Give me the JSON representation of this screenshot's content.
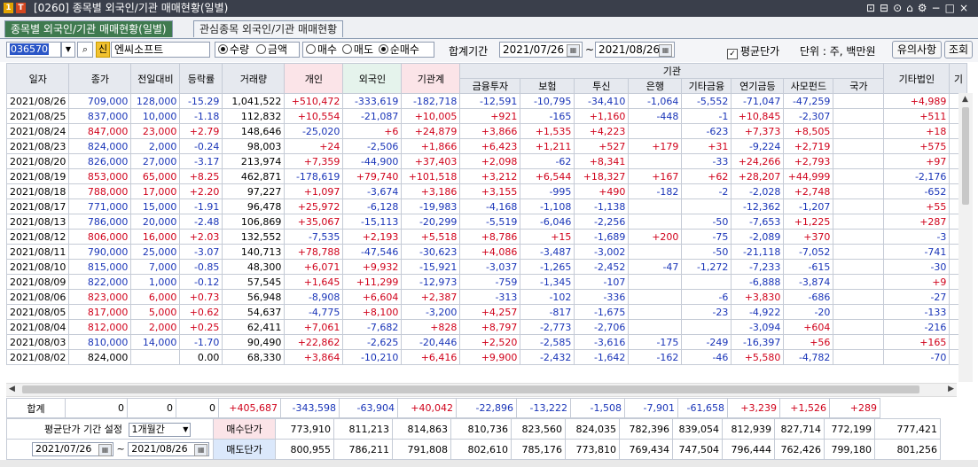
{
  "window": {
    "badge1": "1",
    "badge2": "T",
    "title": "[0260] 종목별 외국인/기관 매매현황(일별)",
    "controls": [
      "⊡",
      "⊟",
      "⊙",
      "⌂",
      "⚙",
      "−",
      "□",
      "×"
    ]
  },
  "tabs": [
    {
      "label": "종목별 외국인/기관 매매현황(일별)",
      "active": true
    },
    {
      "label": "관심종목 외국인/기관 매매현황",
      "active": false
    }
  ],
  "toolbar": {
    "code": "036570",
    "stock_badge": "신",
    "stock_name": "엔씨소프트",
    "radio_qty": "수량",
    "radio_amount": "금액",
    "radio_buy": "매수",
    "radio_sell": "매도",
    "radio_net": "순매수",
    "period_label": "합계기간",
    "date_from": "2021/07/26",
    "tilde": "~",
    "date_to": "2021/08/26",
    "avg_price_label": "평균단가",
    "unit_label": "단위 : 주, 백만원",
    "notice_button": "유의사항",
    "query_button": "조회"
  },
  "table": {
    "headers": {
      "date": "일자",
      "price": "종가",
      "change": "전일대비",
      "rate": "등락률",
      "volume": "거래량",
      "individual": "개인",
      "foreign": "외국인",
      "inst_total": "기관계",
      "inst_group": "기관",
      "inst_sub": [
        "금융투자",
        "보험",
        "투신",
        "은행",
        "기타금융",
        "연기금등",
        "사모펀드"
      ],
      "nation": "국가",
      "other_corp": "기타법인",
      "other_foreign": "기"
    },
    "rows": [
      [
        "2021/08/26",
        "709,000",
        "128,000",
        "-15.29",
        "1,041,522",
        "+510,472",
        "-333,619",
        "-182,718",
        "-12,591",
        "-10,795",
        "-34,410",
        "-1,064",
        "-5,552",
        "-71,047",
        "-47,259",
        "",
        "+4,989"
      ],
      [
        "2021/08/25",
        "837,000",
        "10,000",
        "-1.18",
        "112,832",
        "+10,554",
        "-21,087",
        "+10,005",
        "+921",
        "-165",
        "+1,160",
        "-448",
        "-1",
        "+10,845",
        "-2,307",
        "",
        "+511"
      ],
      [
        "2021/08/24",
        "847,000",
        "23,000",
        "+2.79",
        "148,646",
        "-25,020",
        "+6",
        "+24,879",
        "+3,866",
        "+1,535",
        "+4,223",
        "",
        "-623",
        "+7,373",
        "+8,505",
        "",
        "+18"
      ],
      [
        "2021/08/23",
        "824,000",
        "2,000",
        "-0.24",
        "98,003",
        "+24",
        "-2,506",
        "+1,866",
        "+6,423",
        "+1,211",
        "+527",
        "+179",
        "+31",
        "-9,224",
        "+2,719",
        "",
        "+575"
      ],
      [
        "2021/08/20",
        "826,000",
        "27,000",
        "-3.17",
        "213,974",
        "+7,359",
        "-44,900",
        "+37,403",
        "+2,098",
        "-62",
        "+8,341",
        "",
        "-33",
        "+24,266",
        "+2,793",
        "",
        "+97"
      ],
      [
        "2021/08/19",
        "853,000",
        "65,000",
        "+8.25",
        "462,871",
        "-178,619",
        "+79,740",
        "+101,518",
        "+3,212",
        "+6,544",
        "+18,327",
        "+167",
        "+62",
        "+28,207",
        "+44,999",
        "",
        "-2,176"
      ],
      [
        "2021/08/18",
        "788,000",
        "17,000",
        "+2.20",
        "97,227",
        "+1,097",
        "-3,674",
        "+3,186",
        "+3,155",
        "-995",
        "+490",
        "-182",
        "-2",
        "-2,028",
        "+2,748",
        "",
        "-652"
      ],
      [
        "2021/08/17",
        "771,000",
        "15,000",
        "-1.91",
        "96,478",
        "+25,972",
        "-6,128",
        "-19,983",
        "-4,168",
        "-1,108",
        "-1,138",
        "",
        "",
        "-12,362",
        "-1,207",
        "",
        "+55"
      ],
      [
        "2021/08/13",
        "786,000",
        "20,000",
        "-2.48",
        "106,869",
        "+35,067",
        "-15,113",
        "-20,299",
        "-5,519",
        "-6,046",
        "-2,256",
        "",
        "-50",
        "-7,653",
        "+1,225",
        "",
        "+287"
      ],
      [
        "2021/08/12",
        "806,000",
        "16,000",
        "+2.03",
        "132,552",
        "-7,535",
        "+2,193",
        "+5,518",
        "+8,786",
        "+15",
        "-1,689",
        "+200",
        "-75",
        "-2,089",
        "+370",
        "",
        "-3"
      ],
      [
        "2021/08/11",
        "790,000",
        "25,000",
        "-3.07",
        "140,713",
        "+78,788",
        "-47,546",
        "-30,623",
        "+4,086",
        "-3,487",
        "-3,002",
        "",
        "-50",
        "-21,118",
        "-7,052",
        "",
        "-741"
      ],
      [
        "2021/08/10",
        "815,000",
        "7,000",
        "-0.85",
        "48,300",
        "+6,071",
        "+9,932",
        "-15,921",
        "-3,037",
        "-1,265",
        "-2,452",
        "-47",
        "-1,272",
        "-7,233",
        "-615",
        "",
        "-30"
      ],
      [
        "2021/08/09",
        "822,000",
        "1,000",
        "-0.12",
        "57,545",
        "+1,645",
        "+11,299",
        "-12,973",
        "-759",
        "-1,345",
        "-107",
        "",
        "",
        "-6,888",
        "-3,874",
        "",
        "+9"
      ],
      [
        "2021/08/06",
        "823,000",
        "6,000",
        "+0.73",
        "56,948",
        "-8,908",
        "+6,604",
        "+2,387",
        "-313",
        "-102",
        "-336",
        "",
        "-6",
        "+3,830",
        "-686",
        "",
        "-27"
      ],
      [
        "2021/08/05",
        "817,000",
        "5,000",
        "+0.62",
        "54,637",
        "-4,775",
        "+8,100",
        "-3,200",
        "+4,257",
        "-817",
        "-1,675",
        "",
        "-23",
        "-4,922",
        "-20",
        "",
        "-133"
      ],
      [
        "2021/08/04",
        "812,000",
        "2,000",
        "+0.25",
        "62,411",
        "+7,061",
        "-7,682",
        "+828",
        "+8,797",
        "-2,773",
        "-2,706",
        "",
        "",
        "-3,094",
        "+604",
        "",
        "-216"
      ],
      [
        "2021/08/03",
        "810,000",
        "14,000",
        "-1.70",
        "90,490",
        "+22,862",
        "-2,625",
        "-20,446",
        "+2,520",
        "-2,585",
        "-3,616",
        "-175",
        "-249",
        "-16,397",
        "+56",
        "",
        "+165"
      ],
      [
        "2021/08/02",
        "824,000",
        "",
        "0.00",
        "68,330",
        "+3,864",
        "-10,210",
        "+6,416",
        "+9,900",
        "-2,432",
        "-1,642",
        "-162",
        "-46",
        "+5,580",
        "-4,782",
        "",
        "-70"
      ]
    ]
  },
  "totals": {
    "label": "합계",
    "values": [
      "0",
      "0",
      "0",
      "+405,687",
      "-343,598",
      "-63,904",
      "+40,042",
      "-22,896",
      "-13,222",
      "-1,508",
      "-7,901",
      "-61,658",
      "+3,239",
      "+1,526",
      "+289"
    ]
  },
  "avg_setting": {
    "label": "평균단가 기간 설정",
    "period_select": "1개월간",
    "date_from": "2021/07/26",
    "date_to": "2021/08/26",
    "buy_label": "매수단가",
    "sell_label": "매도단가",
    "buy_values": [
      "773,910",
      "811,213",
      "814,863",
      "810,736",
      "823,560",
      "824,035",
      "782,396",
      "839,054",
      "812,939",
      "827,714",
      "772,199",
      "777,421"
    ],
    "sell_values": [
      "800,955",
      "786,211",
      "791,808",
      "802,610",
      "785,176",
      "773,810",
      "769,434",
      "747,504",
      "796,444",
      "762,426",
      "799,180",
      "801,256"
    ]
  },
  "colors": {
    "positive": "#d0021b",
    "negative": "#1a35b8",
    "tab_active": "#3f7a4f"
  },
  "icons": [
    "search-icon",
    "calendar-icon",
    "dropdown-icon",
    "checkbox-icon",
    "scroll-left-icon",
    "scroll-right-icon"
  ]
}
